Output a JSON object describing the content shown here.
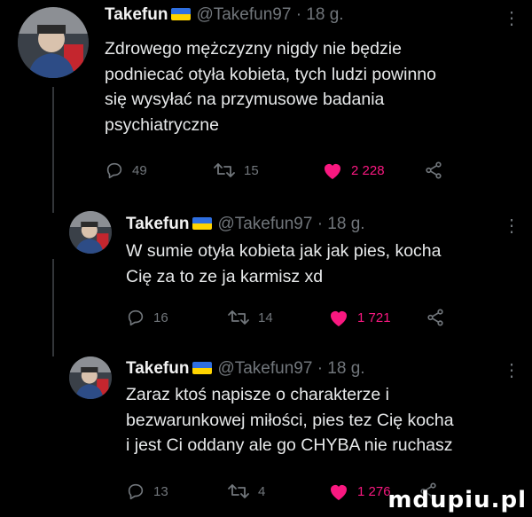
{
  "tweets": [
    {
      "name": "Takefun",
      "handle": "@Takefun97",
      "time": "· 18 g.",
      "text_lines": [
        "Zdrowego mężczyzny nigdy nie będzie",
        "podniecać otyła kobieta, tych ludzi powinno",
        "się wysyłać na przymusowe badania",
        "psychiatryczne"
      ],
      "replies": "49",
      "retweets": "15",
      "likes": "2 228"
    },
    {
      "name": "Takefun",
      "handle": "@Takefun97",
      "time": "· 18 g.",
      "text_lines": [
        "W sumie otyła kobieta jak jak pies, kocha",
        "Cię za to ze ja karmisz xd"
      ],
      "replies": "16",
      "retweets": "14",
      "likes": "1 721"
    },
    {
      "name": "Takefun",
      "handle": "@Takefun97",
      "time": "· 18 g.",
      "text_lines": [
        "Zaraz ktoś napisze o charakterze i",
        "bezwarunkowej miłości, pies tez Cię kocha",
        "i jest Ci oddany ale go CHYBA nie ruchasz"
      ],
      "replies": "13",
      "retweets": "4",
      "likes": "1 276"
    }
  ],
  "icons": {
    "reply": "reply-icon",
    "retweet": "retweet-icon",
    "like": "heart-icon",
    "share": "share-icon",
    "more": "more-icon"
  },
  "colors": {
    "background": "#000000",
    "text": "#e7e9ea",
    "secondary": "#71767b",
    "like": "#f91880",
    "flag_blue": "#2f6fe0",
    "flag_yellow": "#ffd400"
  },
  "watermark": "mdupiu.pl"
}
